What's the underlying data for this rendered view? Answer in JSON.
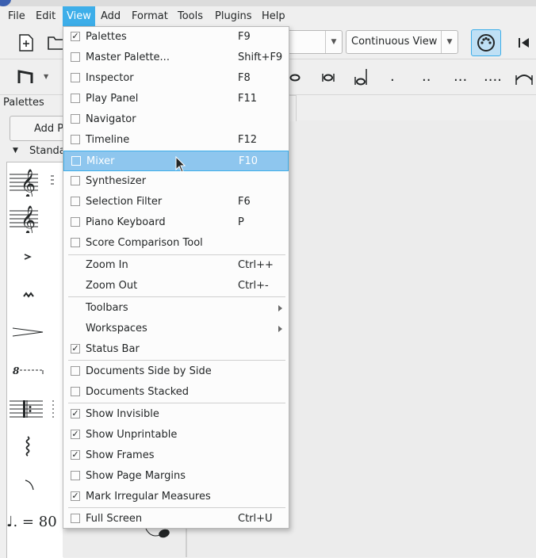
{
  "menubar": {
    "items": [
      {
        "label": "File"
      },
      {
        "label": "Edit"
      },
      {
        "label": "View"
      },
      {
        "label": "Add"
      },
      {
        "label": "Format"
      },
      {
        "label": "Tools"
      },
      {
        "label": "Plugins"
      },
      {
        "label": "Help"
      }
    ]
  },
  "toolbar": {
    "view_mode": "Continuous View"
  },
  "palettes": {
    "title": "Palettes",
    "add_button": "Add P",
    "section": "Standa",
    "tempo_text": "♩. = 80",
    "octave_text": "8"
  },
  "view_menu": {
    "items": [
      {
        "label": "Palettes",
        "shortcut": "F9",
        "checked": true
      },
      {
        "label": "Master Palette...",
        "shortcut": "Shift+F9",
        "checked": false
      },
      {
        "label": "Inspector",
        "shortcut": "F8",
        "checked": false
      },
      {
        "label": "Play Panel",
        "shortcut": "F11",
        "checked": false
      },
      {
        "label": "Navigator",
        "shortcut": "",
        "checked": false
      },
      {
        "label": "Timeline",
        "shortcut": "F12",
        "checked": false
      },
      {
        "label": "Mixer",
        "shortcut": "F10",
        "checked": false
      },
      {
        "label": "Synthesizer",
        "shortcut": "",
        "checked": false
      },
      {
        "label": "Selection Filter",
        "shortcut": "F6",
        "checked": false
      },
      {
        "label": "Piano Keyboard",
        "shortcut": "P",
        "checked": false
      },
      {
        "label": "Score Comparison Tool",
        "shortcut": "",
        "checked": false
      },
      {
        "label": "Zoom In",
        "shortcut": "Ctrl++"
      },
      {
        "label": "Zoom Out",
        "shortcut": "Ctrl+-"
      },
      {
        "label": "Toolbars"
      },
      {
        "label": "Workspaces"
      },
      {
        "label": "Status Bar",
        "checked": true
      },
      {
        "label": "Documents Side by Side",
        "checked": false
      },
      {
        "label": "Documents Stacked",
        "checked": false
      },
      {
        "label": "Show Invisible",
        "checked": true
      },
      {
        "label": "Show Unprintable",
        "checked": true
      },
      {
        "label": "Show Frames",
        "checked": true
      },
      {
        "label": "Show Page Margins",
        "checked": false
      },
      {
        "label": "Mark Irregular Measures",
        "checked": true
      },
      {
        "label": "Full Screen",
        "shortcut": "Ctrl+U",
        "checked": false
      }
    ]
  },
  "colors": {
    "menu_highlight": "#3daee9",
    "item_highlight": "#8ec6ee",
    "panel_bg": "#efefef"
  }
}
